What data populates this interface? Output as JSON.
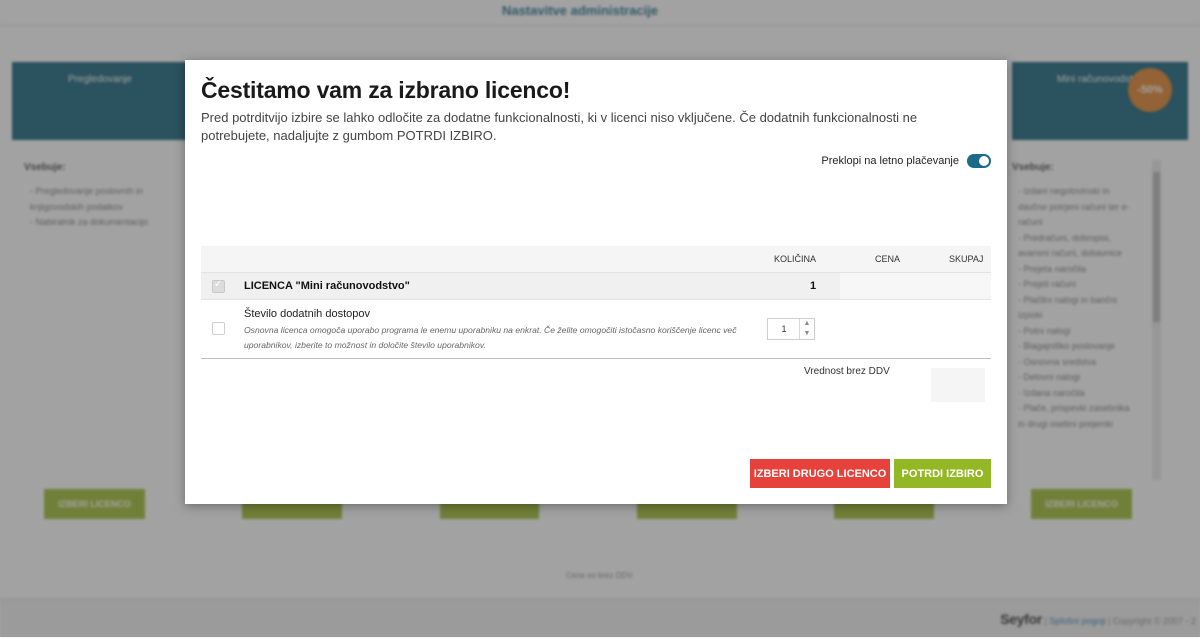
{
  "background": {
    "page_title": "Nastavitve administracije",
    "left_card": {
      "title": "Pregledovanje",
      "contains_label": "Vsebuje:",
      "features": [
        "Pregledovanje poslovnih in knjigovodskih podatkov",
        "Nabiralnik za dokumentacijo"
      ],
      "button": "IZBERI LICENCO"
    },
    "right_card": {
      "title": "Mini računovodstvo",
      "discount": "-50%",
      "contains_label": "Vsebuje:",
      "features": [
        "Izdani negotovinski in davčno potrjeni računi ter e-računi",
        "Predračuni, dobropisi, avansni računi, dobavnice",
        "Prejeta naročila",
        "Prejeti računi",
        "Plačilni nalogi in bančni izpiski",
        "Potni nalogi",
        "Blagajniško poslovanje",
        "Osnovna sredstva",
        "Delovni nalogi",
        "Izdana naročila",
        "Plače, prispevki zasebnika in drugi osebni prejemki"
      ],
      "button": "IZBERI LICENCO"
    },
    "prices_note": "Cene so brez DDV.",
    "footer": {
      "logo": "Seyfor",
      "link": "Splošni pogoji",
      "copyright": "Copyright © 2007 - 2"
    }
  },
  "modal": {
    "title": "Čestitamo vam za izbrano licenco!",
    "description": "Pred potrditvijo izbire se lahko odločite za dodatne funkcionalnosti, ki v licenci niso vključene. Če dodatnih funkcionalnosti ne potrebujete, nadaljujte z gumbom POTRDI IZBIRO.",
    "toggle_label": "Preklopi na letno plačevanje",
    "table": {
      "headers": {
        "quantity": "KOLIČINA",
        "price": "CENA",
        "total": "SKUPAJ"
      },
      "license_row": {
        "label": "LICENCA \"Mini računovodstvo\"",
        "quantity": "1"
      },
      "access_row": {
        "label": "Število dodatnih dostopov",
        "description": "Osnovna licenca omogoča uporabo programa le enemu uporabniku na enkrat. Če želite omogočiti istočasno koriščenje licenc več uporabnikov, izberite to možnost in določite število uporabnikov.",
        "stepper_value": "1"
      }
    },
    "total_label": "Vrednost brez DDV",
    "buttons": {
      "choose_other": "IZBERI DRUGO LICENCO",
      "confirm": "POTRDI IZBIRO"
    }
  },
  "colors": {
    "primary": "#0f5e78",
    "accent_green": "#94b726",
    "danger_red": "#e6413a",
    "discount_orange": "#e07f26"
  }
}
